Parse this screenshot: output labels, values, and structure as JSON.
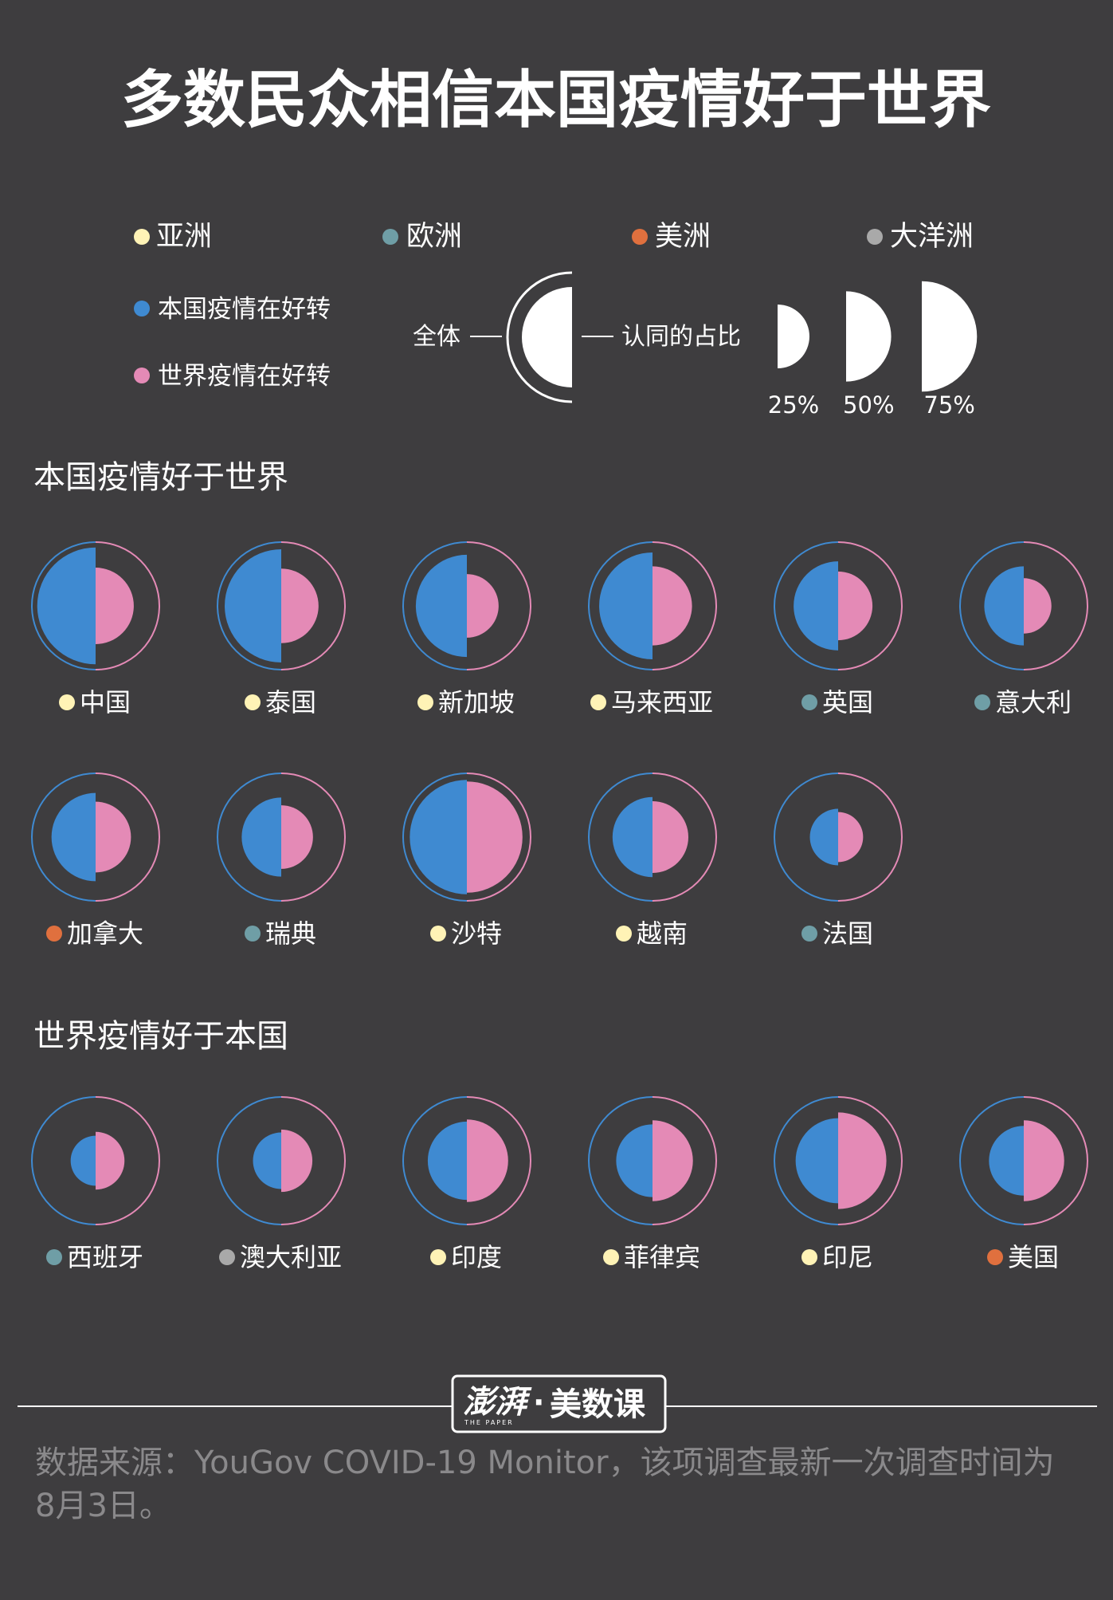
{
  "colors": {
    "background": "#3e3d3f",
    "domestic": "#3f8ad1",
    "world": "#e48ab6",
    "asia": "#fff3b6",
    "europe": "#6f9ea6",
    "americas": "#e0703e",
    "oceania": "#a9a9a9"
  },
  "title": "多数民众相信本国疫情好于世界",
  "legend": {
    "regions": [
      {
        "label": "亚洲",
        "color": "#fff3b6"
      },
      {
        "label": "欧洲",
        "color": "#6f9ea6"
      },
      {
        "label": "美洲",
        "color": "#e0703e"
      },
      {
        "label": "大洋洲",
        "color": "#a9a9a9"
      }
    ],
    "measures": [
      {
        "label": "本国疫情在好转",
        "color": "#3f8ad1"
      },
      {
        "label": "世界疫情在好转",
        "color": "#e48ab6"
      }
    ],
    "whole_label": "全体",
    "share_label": "认同的占比",
    "scale": [
      {
        "label": "25%",
        "value": 25
      },
      {
        "label": "50%",
        "value": 50
      },
      {
        "label": "75%",
        "value": 75
      }
    ]
  },
  "chart_data": {
    "type": "half-circle comparison",
    "unit": "%",
    "left_series": "本国疫情在好转",
    "right_series": "世界疫情在好转",
    "groups": [
      {
        "title": "本国疫情好于世界",
        "countries": [
          {
            "name": "中国",
            "region": "asia",
            "domestic": 98,
            "world": 42
          },
          {
            "name": "泰国",
            "region": "asia",
            "domestic": 92,
            "world": 40
          },
          {
            "name": "新加坡",
            "region": "asia",
            "domestic": 75,
            "world": 29
          },
          {
            "name": "马来西亚",
            "region": "asia",
            "domestic": 82,
            "world": 45
          },
          {
            "name": "英国",
            "region": "europe",
            "domestic": 57,
            "world": 34
          },
          {
            "name": "意大利",
            "region": "europe",
            "domestic": 45,
            "world": 22
          },
          {
            "name": "加拿大",
            "region": "americas",
            "domestic": 56,
            "world": 36
          },
          {
            "name": "瑞典",
            "region": "europe",
            "domestic": 45,
            "world": 29
          },
          {
            "name": "沙特",
            "region": "asia",
            "domestic": 94,
            "world": 89
          },
          {
            "name": "越南",
            "region": "asia",
            "domestic": 46,
            "world": 37
          },
          {
            "name": "法国",
            "region": "europe",
            "domestic": 23,
            "world": 18
          }
        ]
      },
      {
        "title": "世界疫情好于本国",
        "countries": [
          {
            "name": "西班牙",
            "region": "europe",
            "domestic": 18,
            "world": 24
          },
          {
            "name": "澳大利亚",
            "region": "oceania",
            "domestic": 23,
            "world": 28
          },
          {
            "name": "印度",
            "region": "asia",
            "domestic": 44,
            "world": 49
          },
          {
            "name": "菲律宾",
            "region": "asia",
            "domestic": 38,
            "world": 47
          },
          {
            "name": "印尼",
            "region": "asia",
            "domestic": 52,
            "world": 67
          },
          {
            "name": "美国",
            "region": "americas",
            "domestic": 35,
            "world": 47
          }
        ]
      }
    ]
  },
  "brand": {
    "logo_text": "澎湃",
    "logo_subtext": "THE PAPER",
    "separator": "·",
    "name": "美数课"
  },
  "source": "数据来源：YouGov COVID-19 Monitor，该项调查最新一次调查时间为8月3日。"
}
